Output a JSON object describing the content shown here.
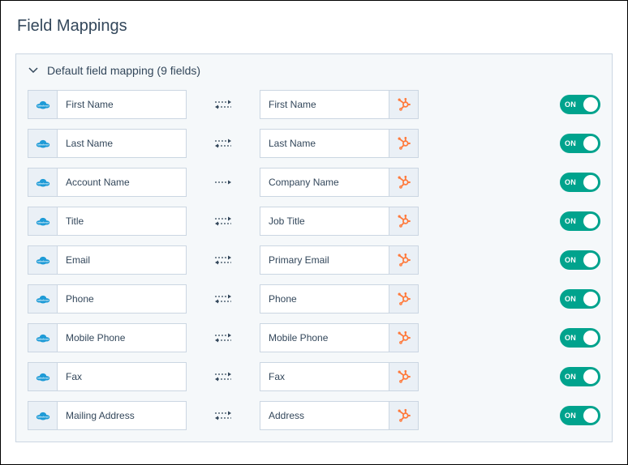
{
  "page_title": "Field Mappings",
  "accordion_label": "Default field mapping (9 fields)",
  "toggle_on_label": "ON",
  "mappings": [
    {
      "source": "First Name",
      "direction": "bidi",
      "target": "First Name",
      "on": true
    },
    {
      "source": "Last Name",
      "direction": "bidi",
      "target": "Last Name",
      "on": true
    },
    {
      "source": "Account Name",
      "direction": "oneway",
      "target": "Company Name",
      "on": true
    },
    {
      "source": "Title",
      "direction": "bidi",
      "target": "Job Title",
      "on": true
    },
    {
      "source": "Email",
      "direction": "bidi",
      "target": "Primary Email",
      "on": true
    },
    {
      "source": "Phone",
      "direction": "bidi",
      "target": "Phone",
      "on": true
    },
    {
      "source": "Mobile Phone",
      "direction": "bidi",
      "target": "Mobile Phone",
      "on": true
    },
    {
      "source": "Fax",
      "direction": "bidi",
      "target": "Fax",
      "on": true
    },
    {
      "source": "Mailing Address",
      "direction": "bidi",
      "target": "Address",
      "on": true
    }
  ]
}
